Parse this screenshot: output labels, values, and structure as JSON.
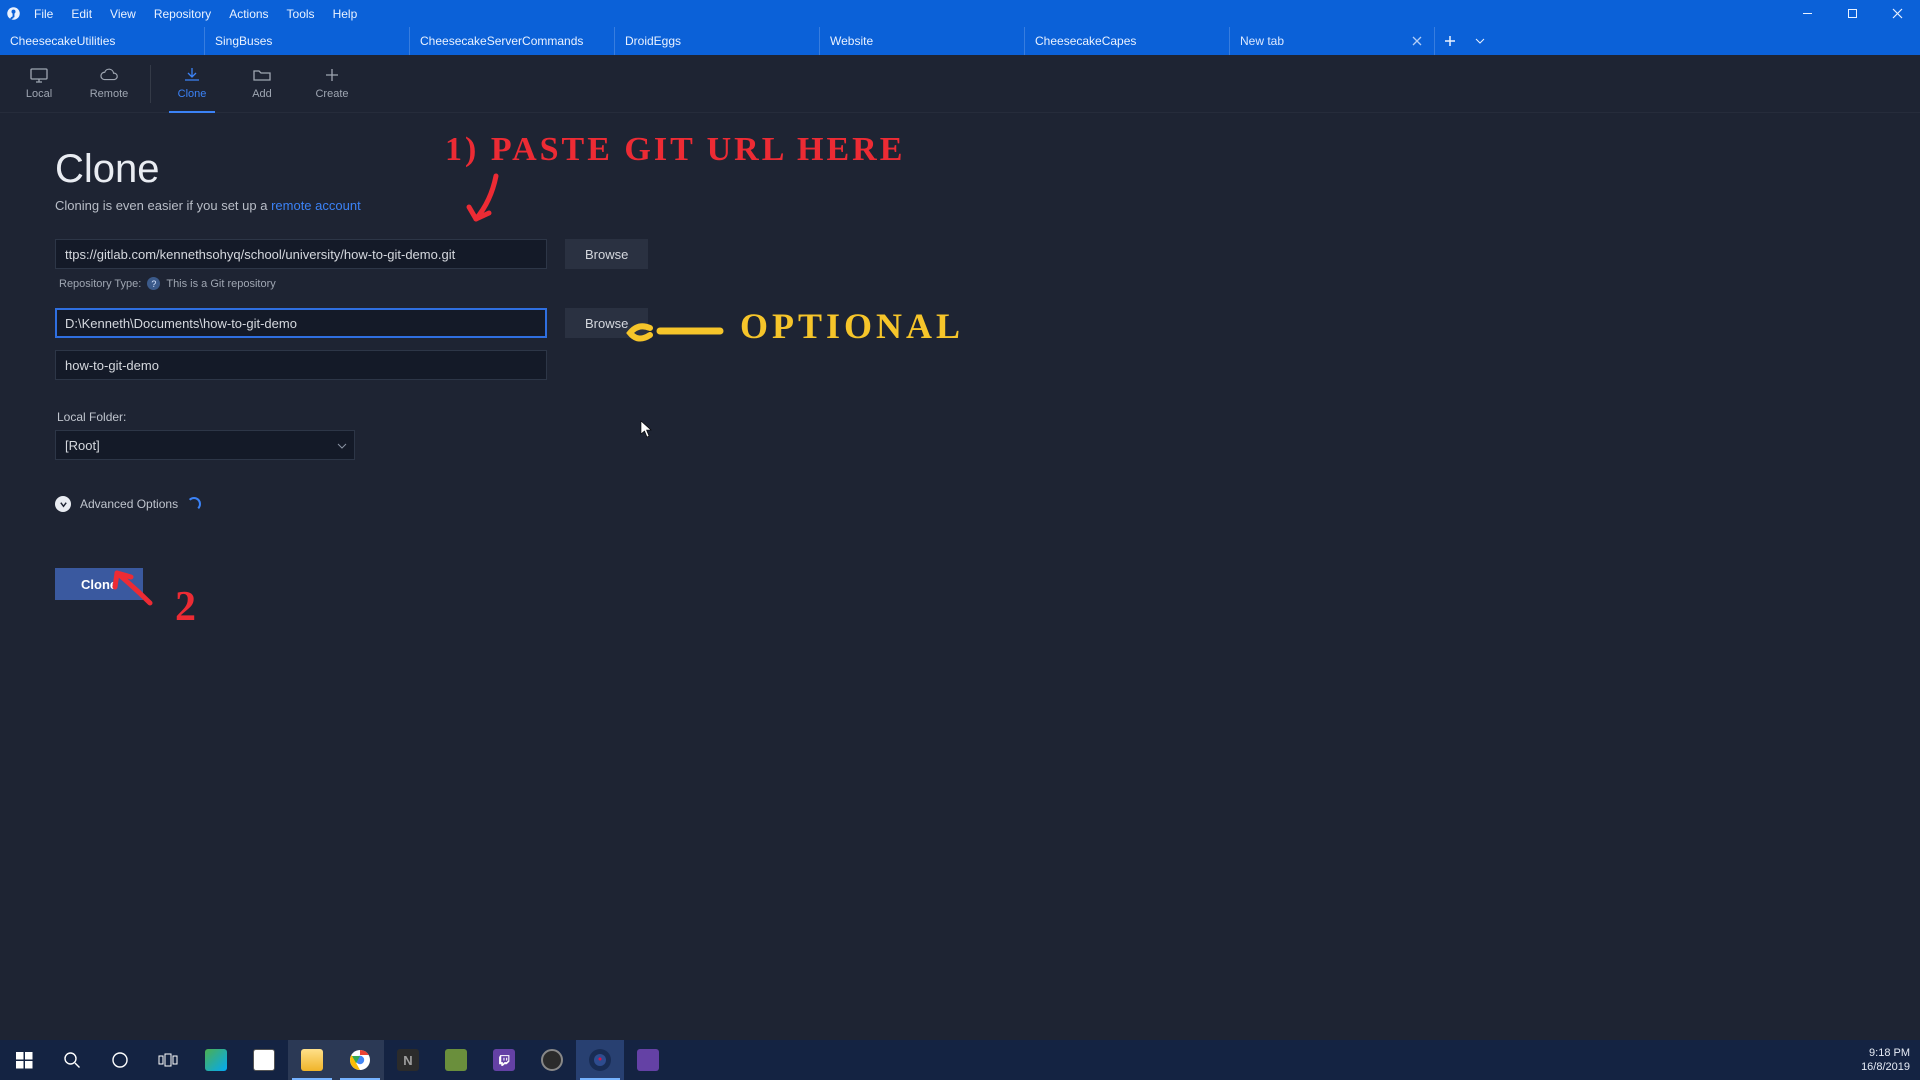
{
  "menus": [
    "File",
    "Edit",
    "View",
    "Repository",
    "Actions",
    "Tools",
    "Help"
  ],
  "tabs": [
    "CheesecakeUtilities",
    "SingBuses",
    "CheesecakeServerCommands",
    "DroidEggs",
    "Website",
    "CheesecakeCapes"
  ],
  "new_tab_label": "New tab",
  "toolbar": {
    "local": "Local",
    "remote": "Remote",
    "clone": "Clone",
    "add": "Add",
    "create": "Create"
  },
  "clone": {
    "title": "Clone",
    "subtitle_prefix": "Cloning is even easier if you set up a ",
    "subtitle_link": "remote account",
    "url_value": "ttps://gitlab.com/kennethsohyq/school/university/how-to-git-demo.git",
    "repo_type_label": "Repository Type:",
    "repo_type_hint": "This is a Git repository",
    "path_value": "D:\\Kenneth\\Documents\\how-to-git-demo",
    "name_value": "how-to-git-demo",
    "local_folder_label": "Local Folder:",
    "local_folder_selected": "[Root]",
    "advanced_label": "Advanced Options",
    "browse_label": "Browse",
    "clone_button": "Clone"
  },
  "annotations": {
    "red_top": "1) PASTE GIT URL HERE",
    "yellow_mid": "OPTIONAL",
    "red_two": "2"
  },
  "clock": {
    "time": "9:18 PM",
    "date": "16/8/2019"
  }
}
